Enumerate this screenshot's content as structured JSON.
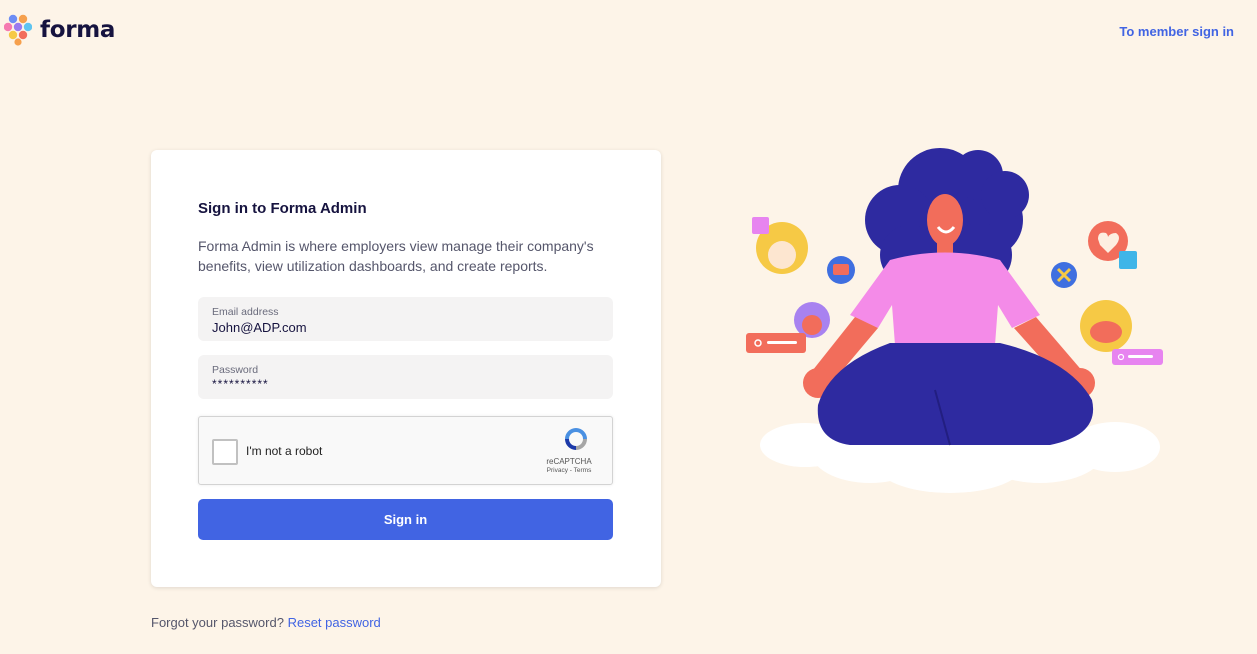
{
  "header": {
    "logo_text": "forma",
    "member_link": "To member sign in"
  },
  "card": {
    "title": "Sign in to Forma Admin",
    "description": "Forma Admin is where employers view manage their company's benefits, view utilization dashboards, and create reports.",
    "email": {
      "label": "Email address",
      "value": "John@ADP.com"
    },
    "password": {
      "label": "Password",
      "value": "**********"
    },
    "captcha": {
      "label": "I'm not a robot",
      "brand": "reCAPTCHA",
      "terms": "Privacy - Terms"
    },
    "signin_label": "Sign in"
  },
  "footer": {
    "forgot_text": "Forgot your password?",
    "reset_link": "Reset password"
  },
  "colors": {
    "background": "#fdf4e8",
    "accent": "#4164e3",
    "text_dark": "#16133f"
  }
}
